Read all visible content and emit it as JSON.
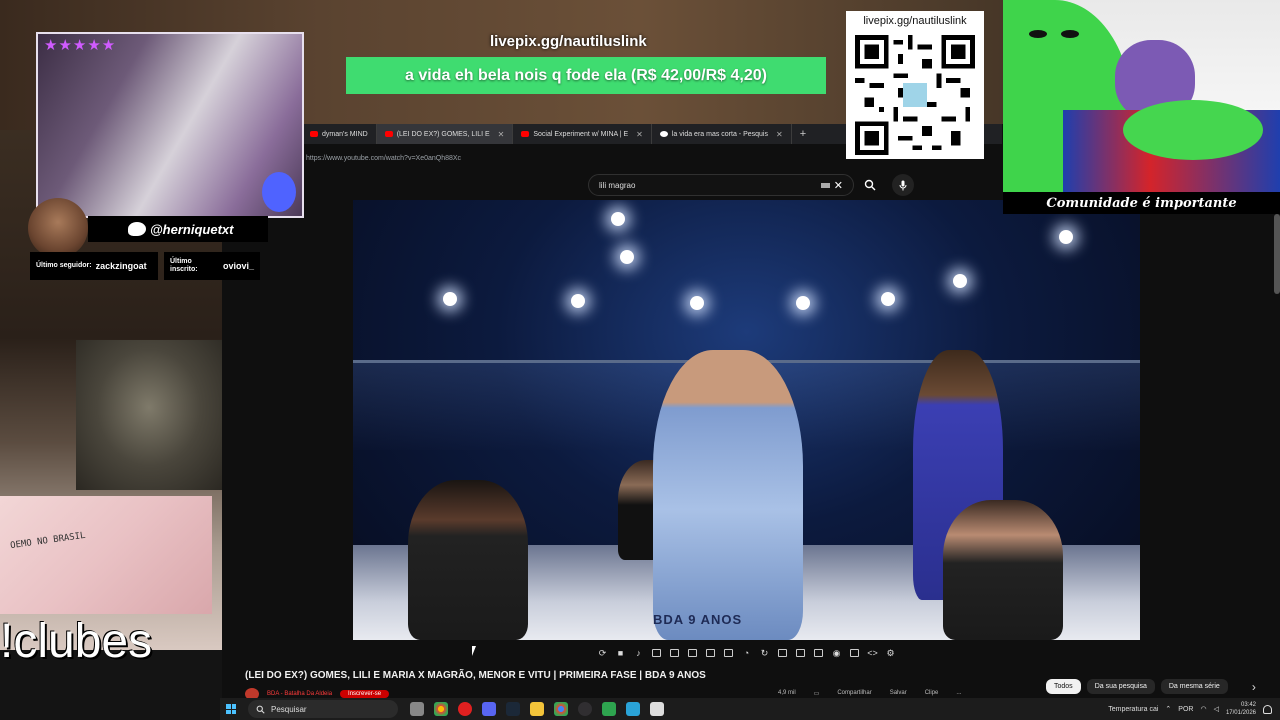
{
  "overlay": {
    "donation_url": "livepix.gg/nautiluslink",
    "donation_message": "a vida eh bela nois q fode ela (R$ 42,00/R$ 4,20)",
    "qr_url": "livepix.gg/nautiluslink",
    "meme_caption": "Comunidade é importante",
    "stars": "★★★★★",
    "twitter_handle": "@herniquetxt",
    "last_follower_label": "Último seguidor:",
    "last_follower_value": "zackzingoat",
    "last_sub_label": "Último inscrito:",
    "last_sub_value": "oviovi_",
    "chat_command": "!clubes",
    "graffiti": "OEMO NO BRASIL"
  },
  "browser": {
    "tabs": [
      {
        "label": "dyman's MIND",
        "active": false
      },
      {
        "label": "(LEI DO EX?) GOMES, LILI E",
        "active": true
      },
      {
        "label": "Social Experiment w/ MINA | E",
        "active": false
      },
      {
        "label": "la vida era mas corta - Pesquis",
        "active": false
      }
    ],
    "new_tab": "+",
    "url": "https://www.youtube.com/watch?v=Xe0anQh88Xc"
  },
  "youtube": {
    "search_query": "lili magrao",
    "video_title": "(LEI DO EX?) GOMES, LILI E MARIA X MAGRÃO, MENOR E VITU | PRIMEIRA FASE | BDA 9 ANOS",
    "channel": "BDA - Batalha Da Aldeia",
    "subscribe": "Inscrever-se",
    "arena_text": "BDA 9 ANOS",
    "actions": [
      "4,9 mil",
      "",
      "Compartilhar",
      "Salvar",
      "Clipe",
      "..."
    ],
    "chips": [
      {
        "label": "Todos",
        "active": true
      },
      {
        "label": "Da sua pesquisa",
        "active": false
      },
      {
        "label": "Da mesma série",
        "active": false
      }
    ]
  },
  "taskbar": {
    "search_placeholder": "Pesquisar",
    "weather": "Temperatura cai",
    "language": "POR",
    "time": "03:42",
    "date": "17/01/2026"
  },
  "colors": {
    "donation_green": "#3fdc70",
    "youtube_red": "#ff0000",
    "star_purple": "#d05bff"
  }
}
